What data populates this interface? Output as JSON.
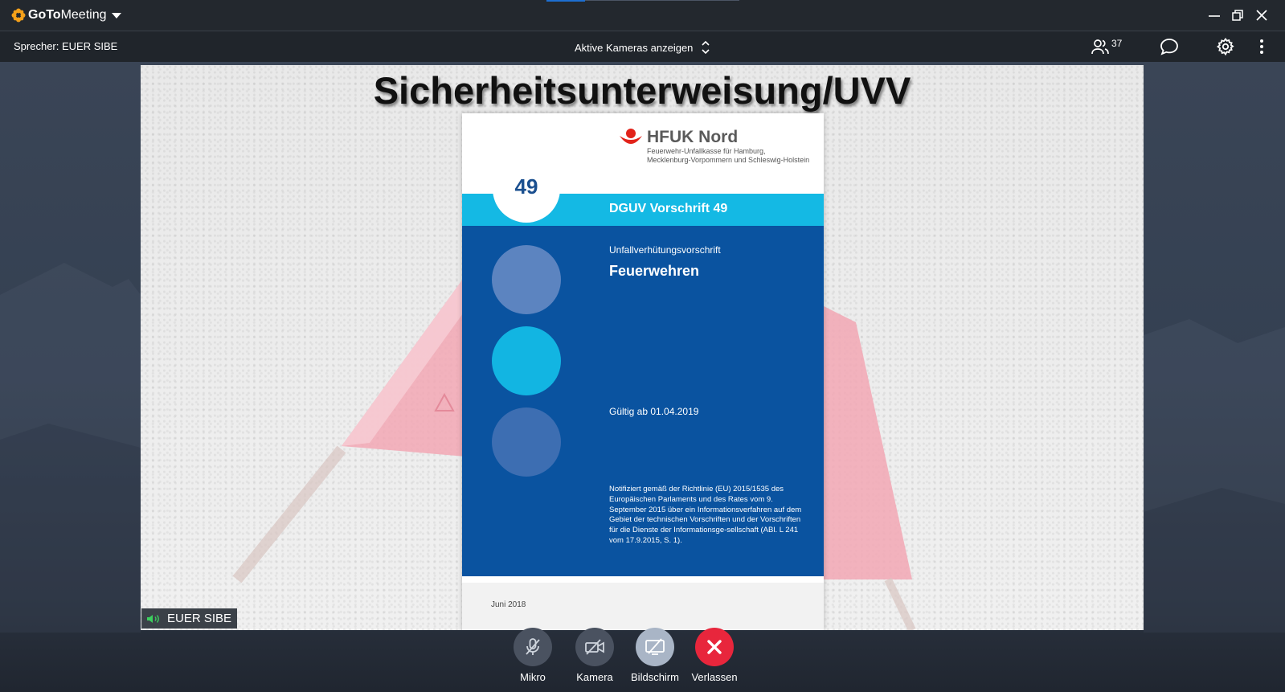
{
  "app": {
    "name_bold": "GoTo",
    "name_rest": "Meeting"
  },
  "toolbar": {
    "speaker": "Sprecher: EUER SIBE",
    "cameras_label": "Aktive Kameras anzeigen",
    "participant_count": "37"
  },
  "slide": {
    "title": "Sicherheitsunterweisung/UVV",
    "booklet": {
      "publisher": "HFUK Nord",
      "publisher_sub_1": "Feuerwehr-Unfallkasse für Hamburg,",
      "publisher_sub_2": "Mecklenburg-Vorpommern und Schleswig-Holstein",
      "number": "49",
      "band_title": "DGUV Vorschrift 49",
      "subtitle": "Unfallverhütungsvorschrift",
      "title": "Feuerwehren",
      "valid": "Gültig ab 01.04.2019",
      "note": "Notifiziert gemäß der Richtlinie (EU) 2015/1535 des Europäischen Parlaments und des Rates vom 9. September 2015 über ein Informationsverfahren auf dem Gebiet der technischen Vorschriften und der Vorschriften für die Dienste der Informationsge-sellschaft (ABl. L 241 vom 17.9.2015, S. 1).",
      "date": "Juni 2018"
    }
  },
  "presenter_tag": "EUER SIBE",
  "controls": {
    "mic": "Mikro",
    "camera": "Kamera",
    "screen": "Bildschirm",
    "leave": "Verlassen"
  },
  "colors": {
    "leave_button": "#e8263c",
    "control_button": "#4a5260",
    "booklet_blue": "#0a53a0",
    "booklet_cyan": "#14b9e4",
    "brand_orange": "#f5a11a"
  }
}
